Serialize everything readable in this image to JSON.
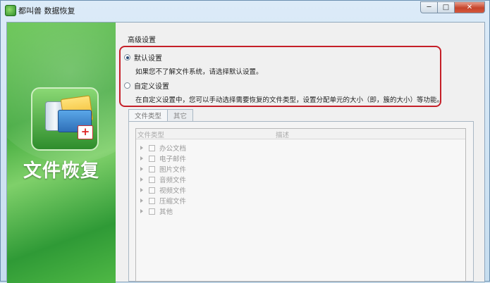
{
  "window": {
    "title": "都叫兽 数据恢复"
  },
  "controls": {
    "minimize": "─",
    "maximize": "□",
    "close": "✕"
  },
  "left_panel": {
    "title": "文件恢复"
  },
  "settings": {
    "group_label": "高级设置",
    "default_option": {
      "label": "默认设置",
      "selected": true,
      "description": "如果您不了解文件系统，请选择默认设置。"
    },
    "custom_option": {
      "label": "自定义设置",
      "selected": false,
      "description": "在自定义设置中，您可以手动选择需要恢复的文件类型，设置分配单元的大小（即，簇的大小）等功能。"
    }
  },
  "tabs": [
    {
      "label": "文件类型",
      "active": true
    },
    {
      "label": "其它",
      "active": false
    }
  ],
  "file_types": {
    "columns": [
      "文件类型",
      "描述"
    ],
    "items": [
      "办公文档",
      "电子邮件",
      "图片文件",
      "音频文件",
      "视频文件",
      "压缩文件",
      "其他"
    ]
  }
}
